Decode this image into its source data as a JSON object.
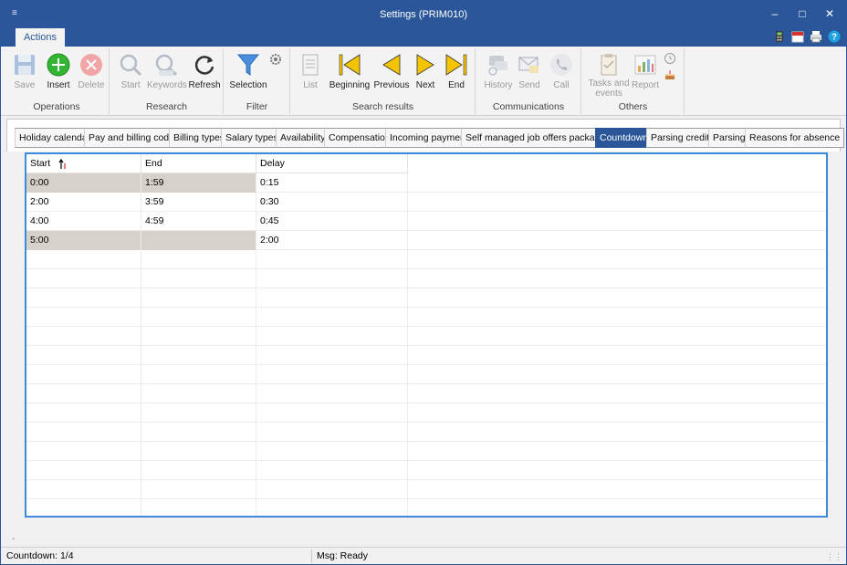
{
  "window": {
    "title": "Settings (PRIM010)"
  },
  "ribbon_tab": "Actions",
  "groups": {
    "operations": {
      "label": "Operations",
      "save": "Save",
      "insert": "Insert",
      "delete": "Delete"
    },
    "research": {
      "label": "Research",
      "start": "Start",
      "keywords": "Keywords",
      "refresh": "Refresh"
    },
    "filter": {
      "label": "Filter",
      "selection": "Selection"
    },
    "search_results": {
      "label": "Search results",
      "list": "List",
      "beginning": "Beginning",
      "previous": "Previous",
      "next": "Next",
      "end": "End"
    },
    "communications": {
      "label": "Communications",
      "history": "History",
      "send": "Send",
      "call": "Call"
    },
    "others": {
      "label": "Others",
      "tasks_line1": "Tasks and",
      "tasks_line2": "events",
      "report": "Report"
    }
  },
  "tabs": [
    "Holiday calendar",
    "Pay and billing codes",
    "Billing types",
    "Salary types",
    "Availability",
    "Compensation",
    "Incoming payment",
    "Self managed job offers packages",
    "Countdown",
    "Parsing credits",
    "Parsing",
    "Reasons for absence"
  ],
  "active_tab": "Countdown",
  "grid": {
    "columns": [
      "Start",
      "End",
      "Delay"
    ],
    "rows": [
      {
        "start": "0:00",
        "end": "1:59",
        "delay": "0:15"
      },
      {
        "start": "2:00",
        "end": "3:59",
        "delay": "0:30"
      },
      {
        "start": "4:00",
        "end": "4:59",
        "delay": "0:45"
      },
      {
        "start": "5:00",
        "end": "",
        "delay": "2:00"
      }
    ]
  },
  "status": {
    "left": "Countdown: 1/4",
    "middle": "Msg: Ready"
  },
  "colors": {
    "accent": "#2b579a",
    "selection": "#d6d2cb",
    "grid_border": "#3c8ad8",
    "nav_yellow": "#f5c400",
    "insert_green": "#35b535",
    "delete_red": "#e8888a"
  }
}
